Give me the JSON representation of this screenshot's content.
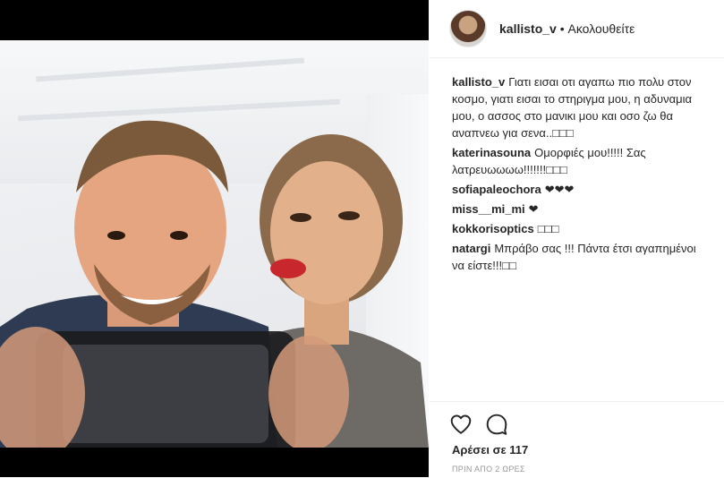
{
  "post": {
    "author": "kallisto_v",
    "follow_status": "Ακολουθείτε",
    "separator": " • "
  },
  "caption": {
    "username": "kallisto_v",
    "text": "Γιατι εισαι οτι αγαπω πιο πολυ στον κοσμο, γιατι εισαι το στηριγμα μου, η αδυναμια μου, ο ασσος στο μανικι μου και οσο ζω θα αναπνεω για σενα..□□□"
  },
  "comments": [
    {
      "username": "katerinasouna",
      "text": "Ομορφιές μου!!!!! Σας λατρευωωωω!!!!!!!□□□"
    },
    {
      "username": "sofiapaleochora",
      "text": "❤❤❤"
    },
    {
      "username": "miss__mi_mi",
      "text": "❤"
    },
    {
      "username": "kokkorisoptics",
      "text": "□□□"
    },
    {
      "username": "natargi",
      "text": "Μπράβο σας !!! Πάντα έτσι αγαπημένοι να είστε!!!□□"
    }
  ],
  "actions": {
    "like_icon": "heart-outline-icon",
    "comment_icon": "speech-bubble-icon"
  },
  "likes_text": "Αρέσει σε 117",
  "timestamp": "ΠΡΙΝ ΑΠΟ 2 ΩΡΕΣ"
}
